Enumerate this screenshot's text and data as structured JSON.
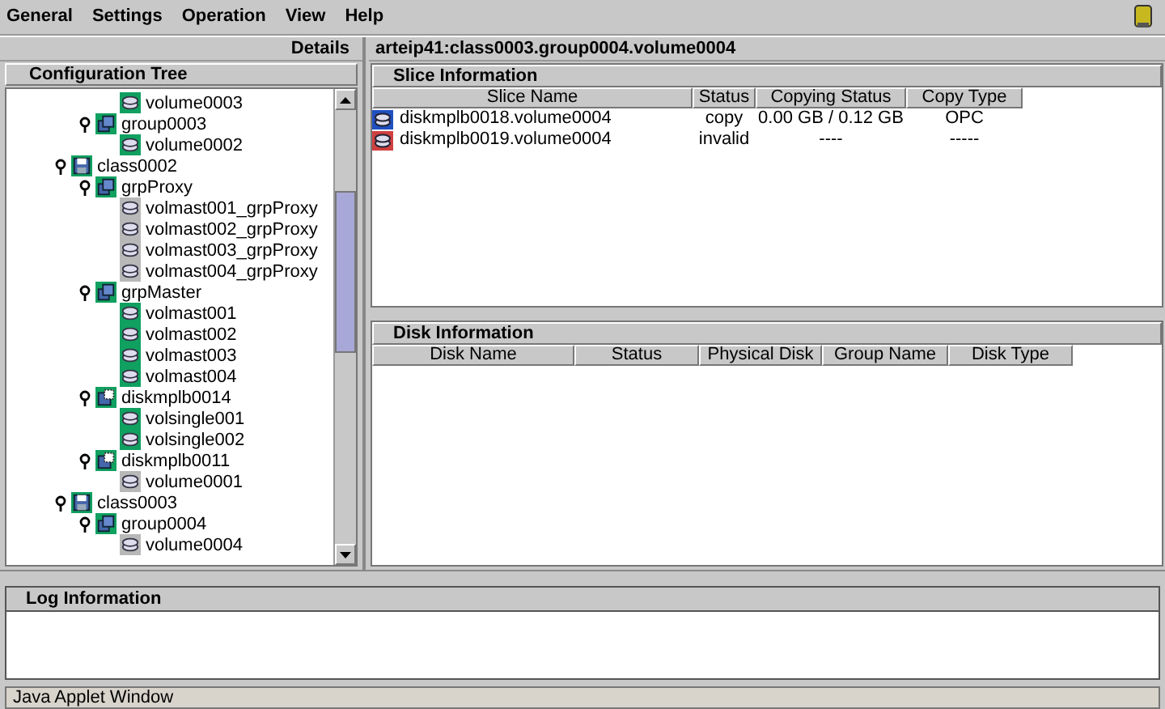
{
  "menu": [
    "General",
    "Settings",
    "Operation",
    "View",
    "Help"
  ],
  "details_label": "Details",
  "tree": {
    "title": "Configuration Tree",
    "items": [
      {
        "children": [
          {
            "children": [
              {
                "label": "volume0003",
                "kind": "volume",
                "color": "#10a060"
              }
            ]
          },
          {
            "label": "group0003",
            "kind": "group",
            "color": "#10a060",
            "expanded": true,
            "children": [
              {
                "label": "volume0002",
                "kind": "volume",
                "color": "#10a060"
              }
            ]
          }
        ]
      },
      {
        "label": "class0002",
        "kind": "class",
        "color": "#10a060",
        "expanded": true,
        "children": [
          {
            "label": "grpProxy",
            "kind": "group",
            "color": "#10a060",
            "expanded": true,
            "children": [
              {
                "label": "volmast001_grpProxy",
                "kind": "volume",
                "color": "#b8b8b8"
              },
              {
                "label": "volmast002_grpProxy",
                "kind": "volume",
                "color": "#b8b8b8"
              },
              {
                "label": "volmast003_grpProxy",
                "kind": "volume",
                "color": "#b8b8b8"
              },
              {
                "label": "volmast004_grpProxy",
                "kind": "volume",
                "color": "#b8b8b8"
              }
            ]
          },
          {
            "label": "grpMaster",
            "kind": "group",
            "color": "#10a060",
            "expanded": true,
            "children": [
              {
                "label": "volmast001",
                "kind": "volume",
                "color": "#10a060"
              },
              {
                "label": "volmast002",
                "kind": "volume",
                "color": "#10a060"
              },
              {
                "label": "volmast003",
                "kind": "volume",
                "color": "#10a060"
              },
              {
                "label": "volmast004",
                "kind": "volume",
                "color": "#10a060"
              }
            ]
          },
          {
            "label": "diskmplb0014",
            "kind": "disk",
            "color": "#10a060",
            "expanded": true,
            "children": [
              {
                "label": "volsingle001",
                "kind": "volume",
                "color": "#10a060"
              },
              {
                "label": "volsingle002",
                "kind": "volume",
                "color": "#10a060"
              }
            ]
          },
          {
            "label": "diskmplb0011",
            "kind": "disk",
            "color": "#10a060",
            "expanded": true,
            "children": [
              {
                "label": "volume0001",
                "kind": "volume",
                "color": "#b8b8b8"
              }
            ]
          }
        ]
      },
      {
        "label": "class0003",
        "kind": "class",
        "color": "#10a060",
        "expanded": true,
        "children": [
          {
            "label": "group0004",
            "kind": "group",
            "color": "#10a060",
            "expanded": true,
            "children": [
              {
                "label": "volume0004",
                "kind": "volume",
                "color": "#b8b8b8"
              }
            ]
          }
        ]
      }
    ]
  },
  "path_title": "arteip41:class0003.group0004.volume0004",
  "slice": {
    "title": "Slice Information",
    "columns": [
      "Slice Name",
      "Status",
      "Copying Status",
      "Copy Type"
    ],
    "rows": [
      {
        "color": "#2050c0",
        "cells": [
          "diskmplb0018.volume0004",
          "copy",
          "0.00 GB / 0.12 GB",
          "OPC"
        ]
      },
      {
        "color": "#d04040",
        "cells": [
          "diskmplb0019.volume0004",
          "invalid",
          "----",
          "-----"
        ]
      }
    ]
  },
  "disk": {
    "title": "Disk Information",
    "columns": [
      "Disk Name",
      "Status",
      "Physical Disk",
      "Group Name",
      "Disk Type"
    ]
  },
  "log": {
    "title": "Log Information"
  },
  "status_bar": "Java Applet Window"
}
